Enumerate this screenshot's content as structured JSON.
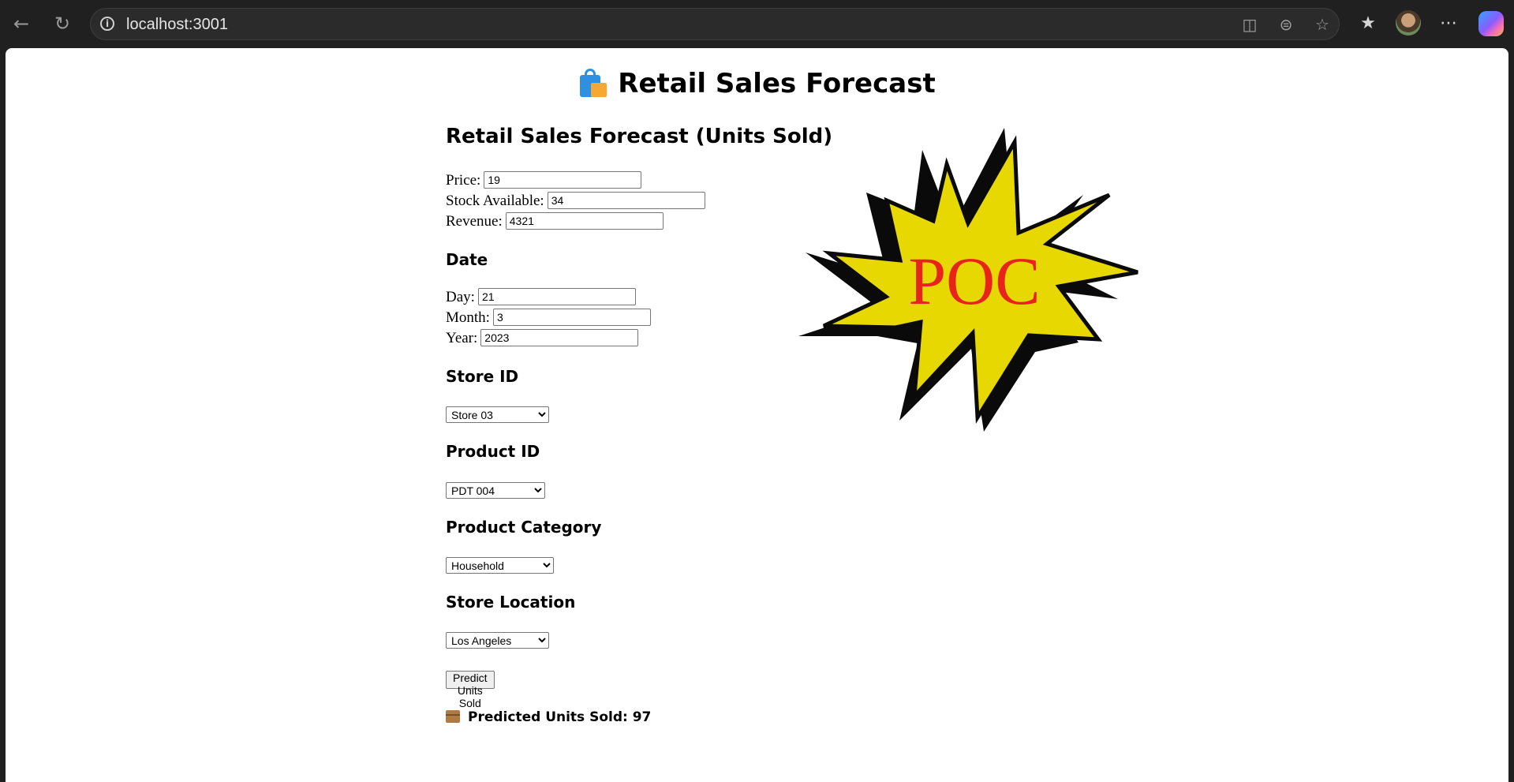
{
  "browser": {
    "url": "localhost:3001",
    "back_icon": "back-arrow-icon",
    "reload_icon": "reload-icon"
  },
  "page": {
    "title": "Retail Sales Forecast",
    "form_heading": "Retail Sales Forecast (Units Sold)",
    "fields": {
      "price": {
        "label": "Price:",
        "value": "19"
      },
      "stock": {
        "label": "Stock Available:",
        "value": "34"
      },
      "revenue": {
        "label": "Revenue:",
        "value": "4321"
      }
    },
    "date": {
      "heading": "Date",
      "day": {
        "label": "Day:",
        "value": "21"
      },
      "month": {
        "label": "Month:",
        "value": "3"
      },
      "year": {
        "label": "Year:",
        "value": "2023"
      }
    },
    "store_id": {
      "heading": "Store ID",
      "selected": "Store 03"
    },
    "product_id": {
      "heading": "Product ID",
      "selected": "PDT 004"
    },
    "product_category": {
      "heading": "Product Category",
      "selected": "Household"
    },
    "store_location": {
      "heading": "Store Location",
      "selected": "Los Angeles"
    },
    "predict_button": "Predict Units Sold",
    "result": "Predicted Units Sold: 97",
    "poc_badge": "POC"
  },
  "colors": {
    "starburst_fill": "#e6d800",
    "starburst_shadow": "#0a0a0a",
    "poc_text": "#e8231a"
  }
}
